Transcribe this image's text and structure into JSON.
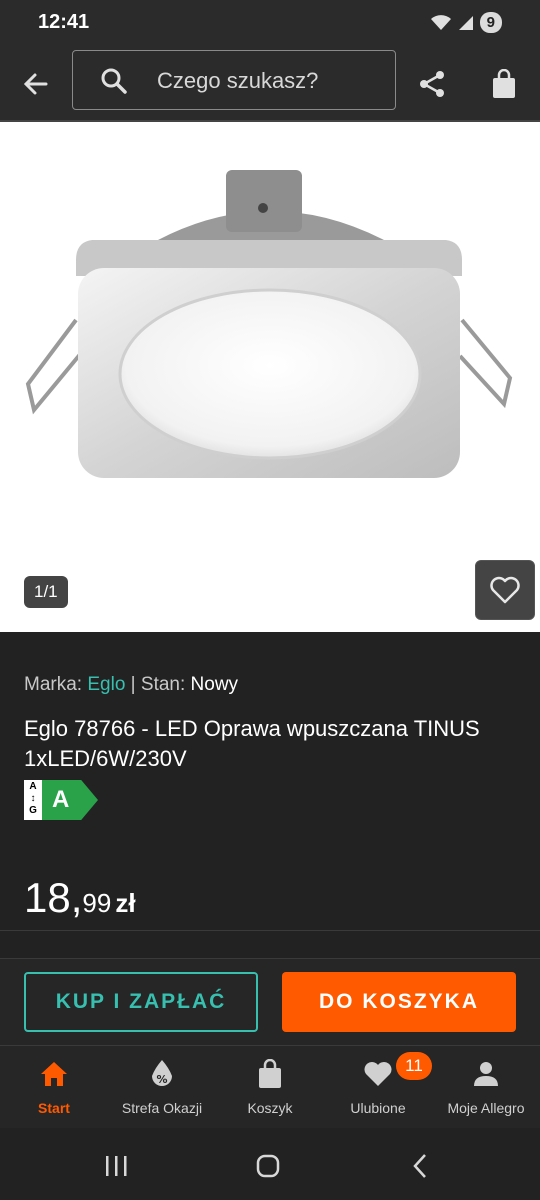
{
  "status_bar": {
    "time": "12:41",
    "battery": "9"
  },
  "toolbar": {
    "search_placeholder": "Czego szukasz?"
  },
  "gallery": {
    "counter": "1/1"
  },
  "product": {
    "brand_label": "Marka:",
    "brand": "Eglo",
    "separator": "|",
    "condition_label": "Stan:",
    "condition": "Nowy",
    "title": "Eglo 78766 - LED Oprawa wpuszczana TINUS 1xLED/6W/230V",
    "energy_scale": [
      "A",
      "G"
    ],
    "energy_class": "A",
    "price_int": "18,",
    "price_dec": "99",
    "currency": "zł"
  },
  "actions": {
    "buy_now": "KUP I ZAPŁAĆ",
    "add_to_cart": "DO KOSZYKA"
  },
  "nav": {
    "items": [
      {
        "label": "Start",
        "icon": "home-icon"
      },
      {
        "label": "Strefa Okazji",
        "icon": "deal-tag-icon"
      },
      {
        "label": "Koszyk",
        "icon": "bag-icon"
      },
      {
        "label": "Ulubione",
        "icon": "heart-icon"
      },
      {
        "label": "Moje Allegro",
        "icon": "person-icon"
      }
    ],
    "favorites_badge": "11"
  },
  "colors": {
    "accent_orange": "#ff5a00",
    "teal": "#37bfb0",
    "energy_green": "#2aa24a"
  }
}
